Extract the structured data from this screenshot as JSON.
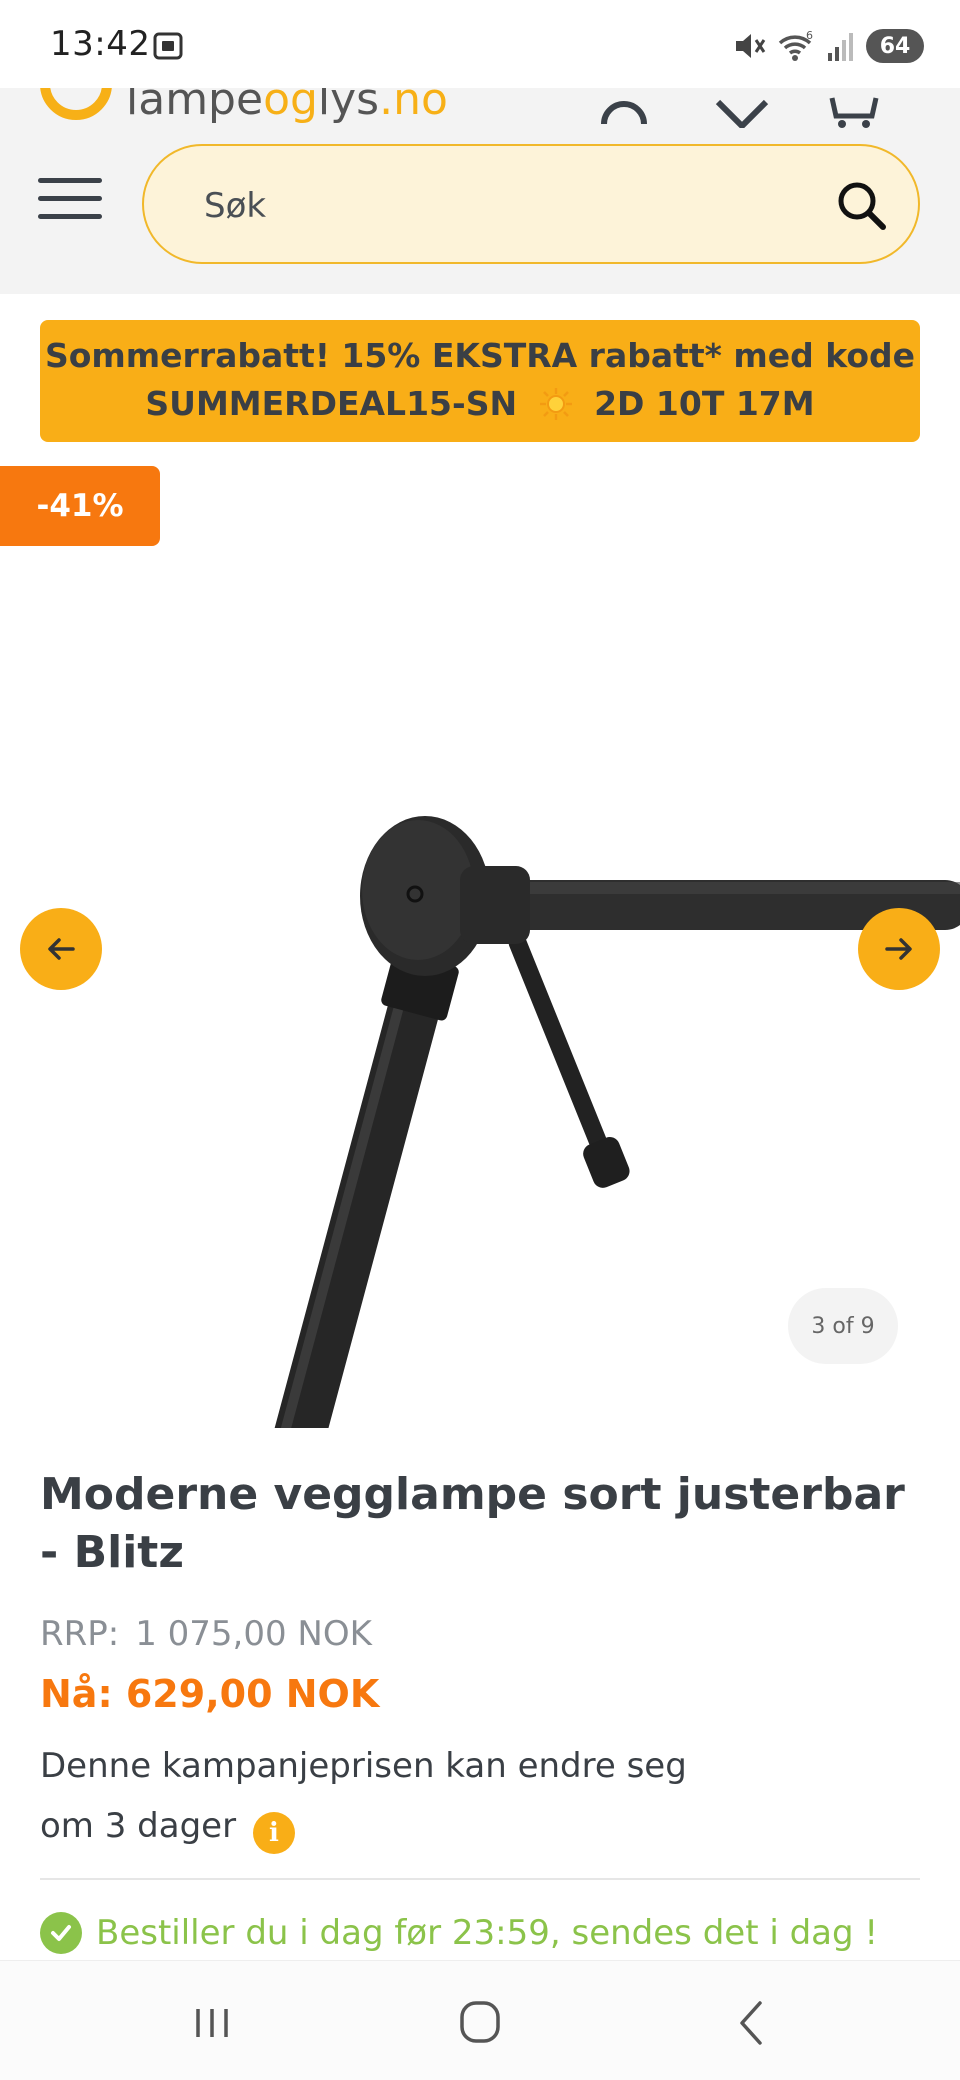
{
  "status_bar": {
    "time": "13:42",
    "battery": "64",
    "icons": [
      "screenshot-icon",
      "mute-icon",
      "wifi-icon",
      "signal-icon",
      "battery-icon"
    ]
  },
  "header": {
    "logo_text_a": "lampe",
    "logo_text_b": "og",
    "logo_text_c": "lys",
    "logo_text_d": ".no",
    "icons": [
      "account-icon",
      "heart-icon",
      "cart-icon"
    ],
    "search_placeholder": "Søk"
  },
  "promo": {
    "line1": "Sommerrabatt! 15% EKSTRA rabatt* med kode",
    "code": "SUMMERDEAL15-SN",
    "countdown": "2D 10T 17M"
  },
  "gallery": {
    "discount_badge": "-41%",
    "counter": "3 of 9"
  },
  "product": {
    "title": "Moderne vegglampe sort justerbar - Blitz",
    "rrp_label": "RRP:",
    "rrp_price": "1 075,00 NOK",
    "now_price": "Nå: 629,00 NOK",
    "campaign_line1": "Denne kampanjeprisen kan endre seg",
    "campaign_line2": "om 3 dager",
    "info_glyph": "i",
    "shipping": "Bestiller du i dag før 23:59, sendes det i dag !"
  },
  "colors": {
    "accent": "#f9ae17",
    "discount": "#f7780f",
    "success": "#8bc34a",
    "text": "#3a3f45"
  }
}
